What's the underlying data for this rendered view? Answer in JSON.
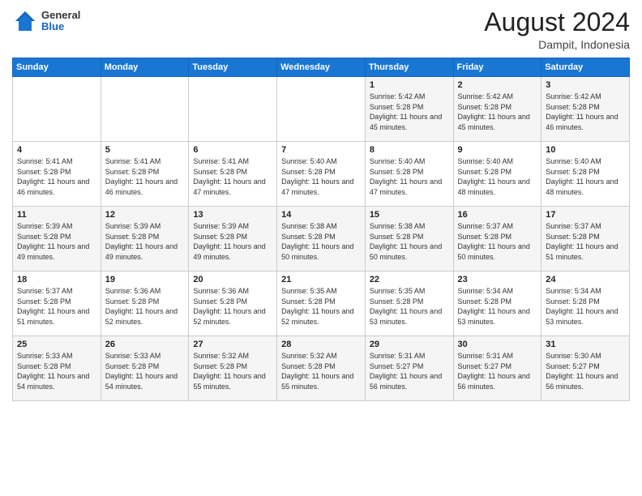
{
  "header": {
    "logo": {
      "general": "General",
      "blue": "Blue"
    },
    "title": "August 2024",
    "subtitle": "Dampit, Indonesia"
  },
  "weekdays": [
    "Sunday",
    "Monday",
    "Tuesday",
    "Wednesday",
    "Thursday",
    "Friday",
    "Saturday"
  ],
  "weeks": [
    [
      {
        "day": "",
        "sunrise": "",
        "sunset": "",
        "daylight": ""
      },
      {
        "day": "",
        "sunrise": "",
        "sunset": "",
        "daylight": ""
      },
      {
        "day": "",
        "sunrise": "",
        "sunset": "",
        "daylight": ""
      },
      {
        "day": "",
        "sunrise": "",
        "sunset": "",
        "daylight": ""
      },
      {
        "day": "1",
        "sunrise": "Sunrise: 5:42 AM",
        "sunset": "Sunset: 5:28 PM",
        "daylight": "Daylight: 11 hours and 45 minutes."
      },
      {
        "day": "2",
        "sunrise": "Sunrise: 5:42 AM",
        "sunset": "Sunset: 5:28 PM",
        "daylight": "Daylight: 11 hours and 45 minutes."
      },
      {
        "day": "3",
        "sunrise": "Sunrise: 5:42 AM",
        "sunset": "Sunset: 5:28 PM",
        "daylight": "Daylight: 11 hours and 46 minutes."
      }
    ],
    [
      {
        "day": "4",
        "sunrise": "Sunrise: 5:41 AM",
        "sunset": "Sunset: 5:28 PM",
        "daylight": "Daylight: 11 hours and 46 minutes."
      },
      {
        "day": "5",
        "sunrise": "Sunrise: 5:41 AM",
        "sunset": "Sunset: 5:28 PM",
        "daylight": "Daylight: 11 hours and 46 minutes."
      },
      {
        "day": "6",
        "sunrise": "Sunrise: 5:41 AM",
        "sunset": "Sunset: 5:28 PM",
        "daylight": "Daylight: 11 hours and 47 minutes."
      },
      {
        "day": "7",
        "sunrise": "Sunrise: 5:40 AM",
        "sunset": "Sunset: 5:28 PM",
        "daylight": "Daylight: 11 hours and 47 minutes."
      },
      {
        "day": "8",
        "sunrise": "Sunrise: 5:40 AM",
        "sunset": "Sunset: 5:28 PM",
        "daylight": "Daylight: 11 hours and 47 minutes."
      },
      {
        "day": "9",
        "sunrise": "Sunrise: 5:40 AM",
        "sunset": "Sunset: 5:28 PM",
        "daylight": "Daylight: 11 hours and 48 minutes."
      },
      {
        "day": "10",
        "sunrise": "Sunrise: 5:40 AM",
        "sunset": "Sunset: 5:28 PM",
        "daylight": "Daylight: 11 hours and 48 minutes."
      }
    ],
    [
      {
        "day": "11",
        "sunrise": "Sunrise: 5:39 AM",
        "sunset": "Sunset: 5:28 PM",
        "daylight": "Daylight: 11 hours and 49 minutes."
      },
      {
        "day": "12",
        "sunrise": "Sunrise: 5:39 AM",
        "sunset": "Sunset: 5:28 PM",
        "daylight": "Daylight: 11 hours and 49 minutes."
      },
      {
        "day": "13",
        "sunrise": "Sunrise: 5:39 AM",
        "sunset": "Sunset: 5:28 PM",
        "daylight": "Daylight: 11 hours and 49 minutes."
      },
      {
        "day": "14",
        "sunrise": "Sunrise: 5:38 AM",
        "sunset": "Sunset: 5:28 PM",
        "daylight": "Daylight: 11 hours and 50 minutes."
      },
      {
        "day": "15",
        "sunrise": "Sunrise: 5:38 AM",
        "sunset": "Sunset: 5:28 PM",
        "daylight": "Daylight: 11 hours and 50 minutes."
      },
      {
        "day": "16",
        "sunrise": "Sunrise: 5:37 AM",
        "sunset": "Sunset: 5:28 PM",
        "daylight": "Daylight: 11 hours and 50 minutes."
      },
      {
        "day": "17",
        "sunrise": "Sunrise: 5:37 AM",
        "sunset": "Sunset: 5:28 PM",
        "daylight": "Daylight: 11 hours and 51 minutes."
      }
    ],
    [
      {
        "day": "18",
        "sunrise": "Sunrise: 5:37 AM",
        "sunset": "Sunset: 5:28 PM",
        "daylight": "Daylight: 11 hours and 51 minutes."
      },
      {
        "day": "19",
        "sunrise": "Sunrise: 5:36 AM",
        "sunset": "Sunset: 5:28 PM",
        "daylight": "Daylight: 11 hours and 52 minutes."
      },
      {
        "day": "20",
        "sunrise": "Sunrise: 5:36 AM",
        "sunset": "Sunset: 5:28 PM",
        "daylight": "Daylight: 11 hours and 52 minutes."
      },
      {
        "day": "21",
        "sunrise": "Sunrise: 5:35 AM",
        "sunset": "Sunset: 5:28 PM",
        "daylight": "Daylight: 11 hours and 52 minutes."
      },
      {
        "day": "22",
        "sunrise": "Sunrise: 5:35 AM",
        "sunset": "Sunset: 5:28 PM",
        "daylight": "Daylight: 11 hours and 53 minutes."
      },
      {
        "day": "23",
        "sunrise": "Sunrise: 5:34 AM",
        "sunset": "Sunset: 5:28 PM",
        "daylight": "Daylight: 11 hours and 53 minutes."
      },
      {
        "day": "24",
        "sunrise": "Sunrise: 5:34 AM",
        "sunset": "Sunset: 5:28 PM",
        "daylight": "Daylight: 11 hours and 53 minutes."
      }
    ],
    [
      {
        "day": "25",
        "sunrise": "Sunrise: 5:33 AM",
        "sunset": "Sunset: 5:28 PM",
        "daylight": "Daylight: 11 hours and 54 minutes."
      },
      {
        "day": "26",
        "sunrise": "Sunrise: 5:33 AM",
        "sunset": "Sunset: 5:28 PM",
        "daylight": "Daylight: 11 hours and 54 minutes."
      },
      {
        "day": "27",
        "sunrise": "Sunrise: 5:32 AM",
        "sunset": "Sunset: 5:28 PM",
        "daylight": "Daylight: 11 hours and 55 minutes."
      },
      {
        "day": "28",
        "sunrise": "Sunrise: 5:32 AM",
        "sunset": "Sunset: 5:28 PM",
        "daylight": "Daylight: 11 hours and 55 minutes."
      },
      {
        "day": "29",
        "sunrise": "Sunrise: 5:31 AM",
        "sunset": "Sunset: 5:27 PM",
        "daylight": "Daylight: 11 hours and 56 minutes."
      },
      {
        "day": "30",
        "sunrise": "Sunrise: 5:31 AM",
        "sunset": "Sunset: 5:27 PM",
        "daylight": "Daylight: 11 hours and 56 minutes."
      },
      {
        "day": "31",
        "sunrise": "Sunrise: 5:30 AM",
        "sunset": "Sunset: 5:27 PM",
        "daylight": "Daylight: 11 hours and 56 minutes."
      }
    ]
  ]
}
